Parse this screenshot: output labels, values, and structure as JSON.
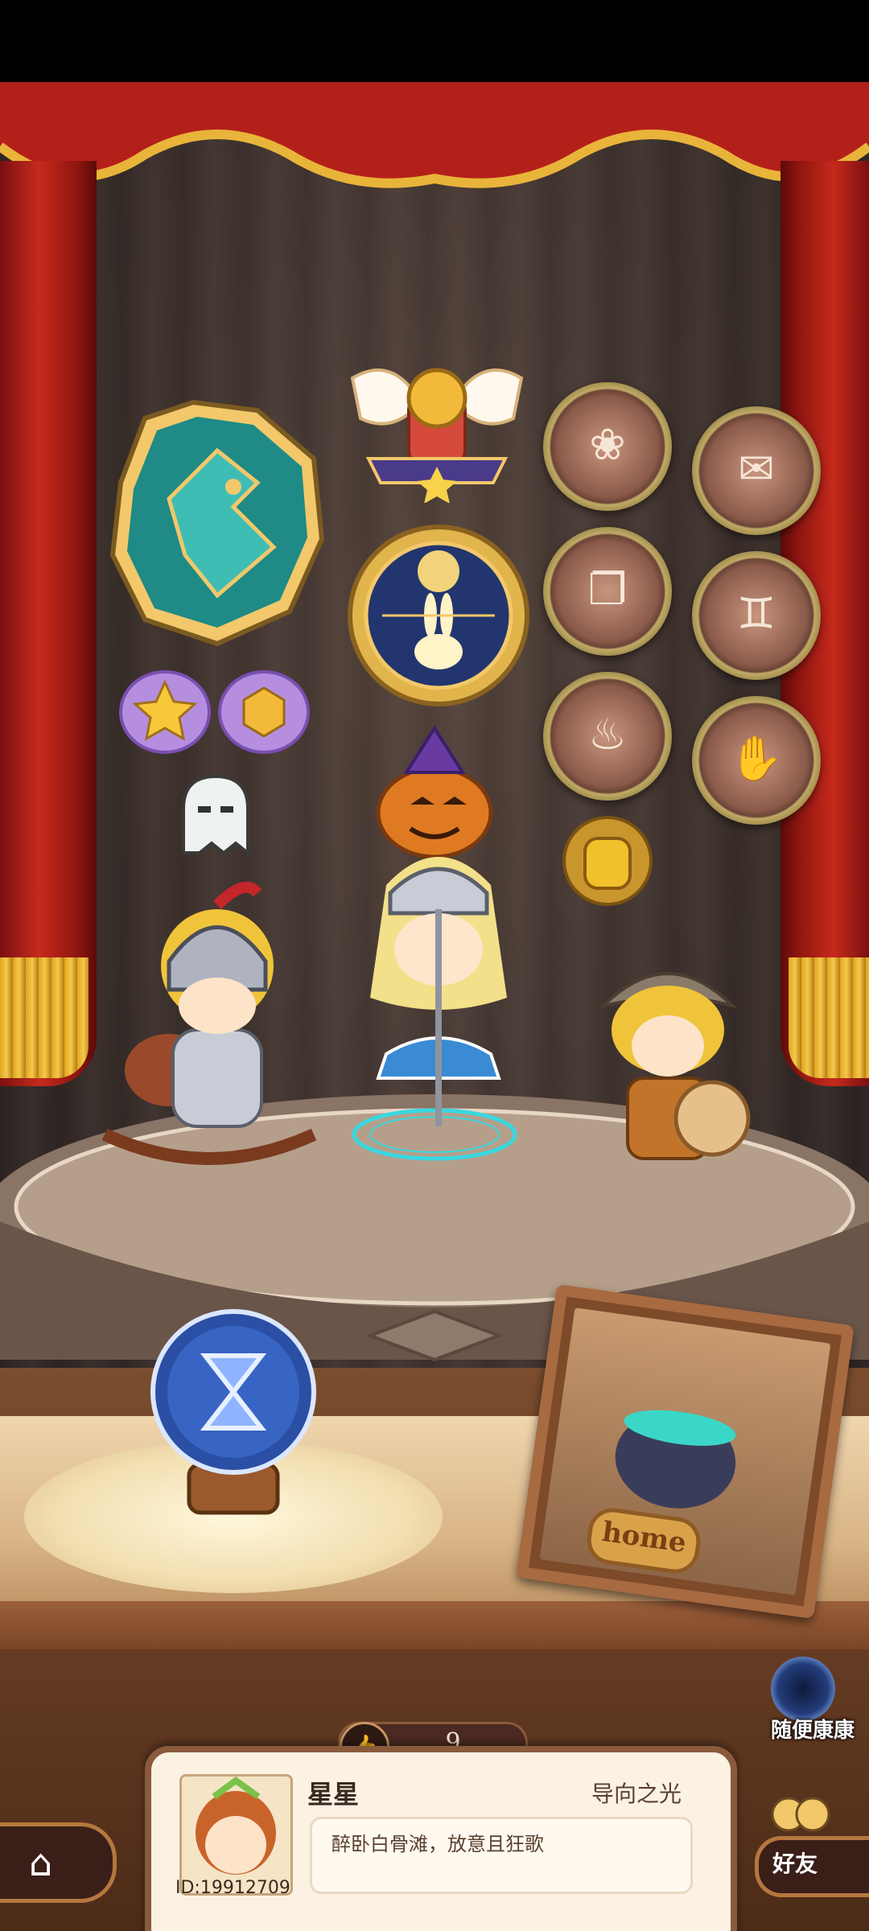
{
  "profile": {
    "name": "星星",
    "title": "导向之光",
    "motto": "醉卧白骨滩，放意且狂歌",
    "user_id": "ID:19912709"
  },
  "likes": {
    "count": "9",
    "icon": "thumbs-up-icon"
  },
  "buttons": {
    "random_visit": "随便康康",
    "friends": "好友",
    "home_icon": "house-icon"
  },
  "stage": {
    "photo_frame_label": "home",
    "crystal_ball_icon": "hourglass-icon"
  },
  "badges": {
    "large": [
      "lion-crest-badge",
      "winged-crown-badge",
      "rabbit-moon-badge"
    ],
    "small": [
      "star-cloud-badge",
      "gem-cloud-badge",
      "ghost-badge",
      "pumpkin-witch-badge",
      "honey-jar-badge"
    ],
    "medals": [
      "flower-medal",
      "scroll-medal",
      "book-medal",
      "twins-medal",
      "teapot-medal",
      "thumbs-up-medal"
    ]
  },
  "characters": [
    "knight-on-rocking-horse",
    "blonde-swordmaiden",
    "dwarf-warrior"
  ]
}
